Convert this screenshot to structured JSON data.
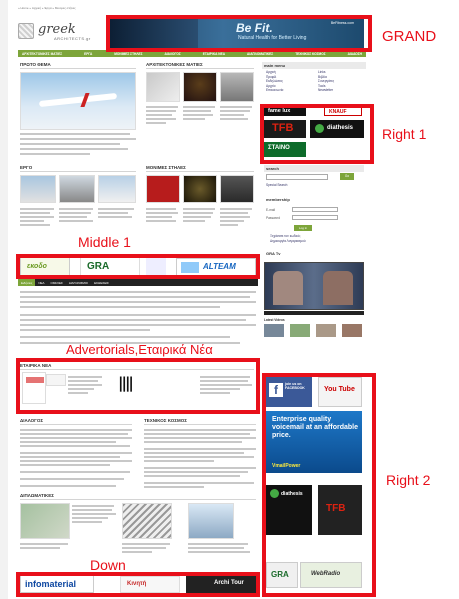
{
  "breadcrumb": "» Home » Αρχική » Έργα » Μονιμες στήλες",
  "logo": {
    "word": "greek",
    "sub": "ARCHITECTS.gr"
  },
  "banners": {
    "grand": {
      "headline": "Be Fit.",
      "tagline": "Natural Health for Better Living",
      "site": "BeFitness.com"
    },
    "right1": [
      "fame lux",
      "TFB",
      "diathesis",
      "ΣΤΑΙΝΟ",
      "KNAUF"
    ],
    "middle1": [
      "εκοδο",
      "GRA",
      "ALTEAM"
    ],
    "right2": [
      "join us on FACEBOOK",
      "You Tube",
      "Enterprise quality voicemail at an affordable price.",
      "VmailPower",
      "diathesis",
      "TFB",
      "GRA",
      "WebRadio"
    ],
    "down": [
      "infomaterial",
      "Κινητή",
      "Archi Tour"
    ]
  },
  "nav": [
    "ΑΡΧΙΤΕΚΤΟΝΙΚΕΣ ΜΑΤΙΕΣ",
    "ΕΡΓΑ",
    "ΜΟΝΙΜΕΣ ΣΤΗΛΕΣ",
    "ΔΙΑΛΟΓΟΣ",
    "ΕΤΑΙΡΙΚΑ ΝΕΑ",
    "ΔΙΑΠΛΟΜΑΤΙΚΕΣ",
    "ΤΕΧΝΙΚΟΣ ΚΟΣΜΟΣ",
    "ΔΙΑΔΟΣΗ"
  ],
  "sections": {
    "proto": "ΠΡΩΤΟ ΘΕΜΑ",
    "arch": "ΑΡΧΙΤΕΚΤΟΝΙΚΕΣ ΜΑΤΙΕΣ",
    "erga": "ΕΡΓΟ",
    "monimes": "ΜΟΝΙΜΕΣ ΣΤΗΛΕΣ",
    "etairika": "ΕΤΑΙΡΙΚΑ ΝΕΑ",
    "dialogos": "ΔΙΑΛΟΓΟΣ",
    "texnikos": "ΤΕΧΝΙΚΟΣ ΚΟΣΜΟΣ",
    "diplomatikes": "ΔΙΠΛΩΜΑΤΙΚΕΣ"
  },
  "sidebar": {
    "main_menu": "main menu",
    "mm_left": [
      "Αρχική",
      "Προφίλ",
      "Εκδηλώσεις",
      "Αρχείο",
      "Επικοινωνία"
    ],
    "mm_right": [
      "Links",
      "Βιβλία",
      "Συνεργάτες",
      "Tools",
      "Newsletter"
    ],
    "search": "search",
    "search_button": "Go",
    "search_link": "Special Search",
    "membership": "membership",
    "email_label": "E-mail",
    "password_label": "Password",
    "login_button": "Log in",
    "forgot": "Ξεχάσατε τον κωδικό;",
    "register": "Δημιουργία Λογαριασμού",
    "gra_tv": "GRA Tv",
    "latest_videos": "Latest Videos"
  },
  "ticker_tabs": [
    "Ειδήσεις",
    "ΝΕΑ",
    "ΟΜΙΛΙΕΣ",
    "ΔΙΑΓΩΝΙΣΜΟΙ",
    "ΕΚΘΕΣΕΙΣ"
  ],
  "zones": {
    "grand": "GRAND",
    "right1": "Right 1",
    "middle1": "Middle 1",
    "advertorials": "Advertorials,Εταιρικά Νέα",
    "right2": "Right 2",
    "down": "Down"
  },
  "colors": {
    "nav_green": "#7da53a",
    "zone_red": "#e8101a"
  }
}
